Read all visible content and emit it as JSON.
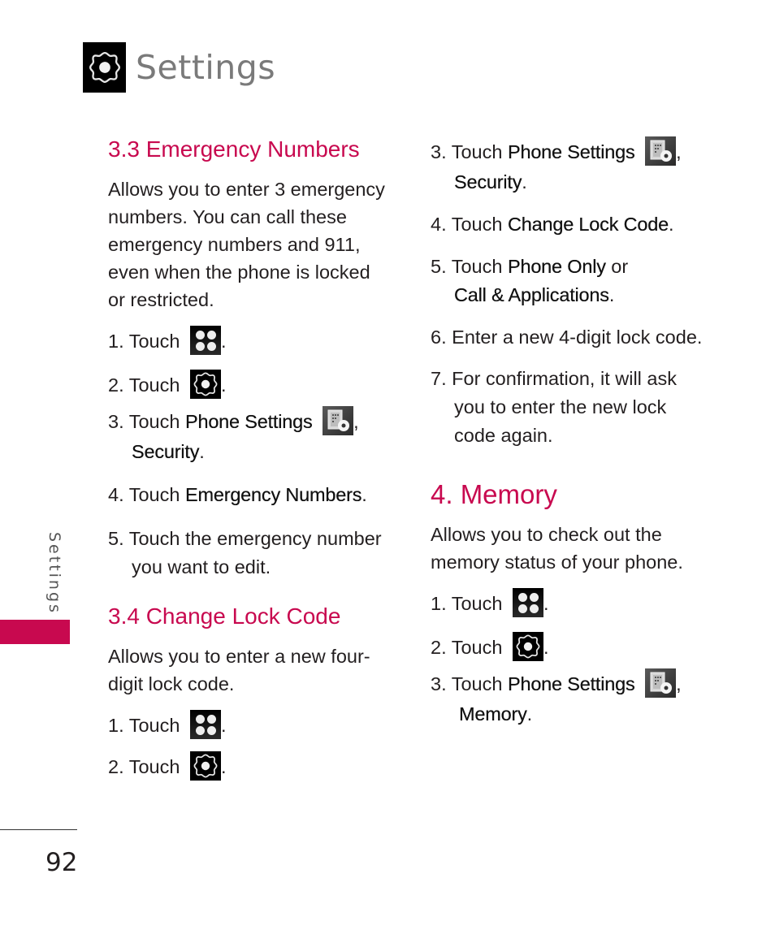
{
  "header": {
    "title": "Settings",
    "icon": "settings-gear-icon"
  },
  "sidebar": {
    "label": "Settings",
    "accent_color": "#c8094f"
  },
  "footer": {
    "page_number": "92"
  },
  "sections": {
    "emergency": {
      "title": "3.3 Emergency Numbers",
      "description": "Allows you to enter 3 emergency numbers. You can call these emergency numbers and 911, even when the phone is locked or restricted.",
      "steps": [
        {
          "num": "1.",
          "text": "Touch",
          "icon": "apps-icon",
          "after": "."
        },
        {
          "num": "2.",
          "text": "Touch",
          "icon": "settings-gear-icon",
          "after": "."
        },
        {
          "num": "3.",
          "text": "Touch",
          "bold": "Phone Settings",
          "icon": "phone-settings-icon",
          "after": ",",
          "line2_bold": "Security",
          "line2_after": "."
        },
        {
          "num": "4.",
          "text": "Touch",
          "bold": "Emergency Numbers",
          "after": "."
        },
        {
          "num": "5.",
          "text": "Touch the emergency number",
          "line2": "you want to edit."
        }
      ]
    },
    "lock": {
      "title": "3.4 Change Lock Code",
      "description": "Allows you to enter a new four-digit lock code.",
      "steps": [
        {
          "num": "1.",
          "text": "Touch",
          "icon": "apps-icon",
          "after": "."
        },
        {
          "num": "2.",
          "text": "Touch",
          "icon": "settings-gear-icon",
          "after": "."
        },
        {
          "num": "3.",
          "text": "Touch",
          "bold": "Phone Settings",
          "icon": "phone-settings-icon",
          "after": ",",
          "line2_bold": "Security",
          "line2_after": "."
        },
        {
          "num": "4.",
          "text": "Touch",
          "bold": "Change Lock Code",
          "after": "."
        },
        {
          "num": "5.",
          "text": "Touch",
          "bold": "Phone Only",
          "after": " or",
          "line2_bold": "Call & Applications",
          "line2_after": "."
        },
        {
          "num": "6.",
          "text": "Enter a new 4-digit lock code."
        },
        {
          "num": "7.",
          "text": "For confirmation, it will ask",
          "line2": "you to enter the new lock",
          "line3": "code again."
        }
      ]
    },
    "memory": {
      "title": "4. Memory",
      "description": "Allows you to check out the memory status of your phone.",
      "steps": [
        {
          "num": "1.",
          "text": "Touch",
          "icon": "apps-icon",
          "after": "."
        },
        {
          "num": "2.",
          "text": "Touch",
          "icon": "settings-gear-icon",
          "after": "."
        },
        {
          "num": "3.",
          "text": "Touch",
          "bold": "Phone Settings",
          "icon": "phone-settings-icon",
          "after": ",",
          "line2_bold": "Memory",
          "line2_after": "."
        }
      ]
    }
  }
}
